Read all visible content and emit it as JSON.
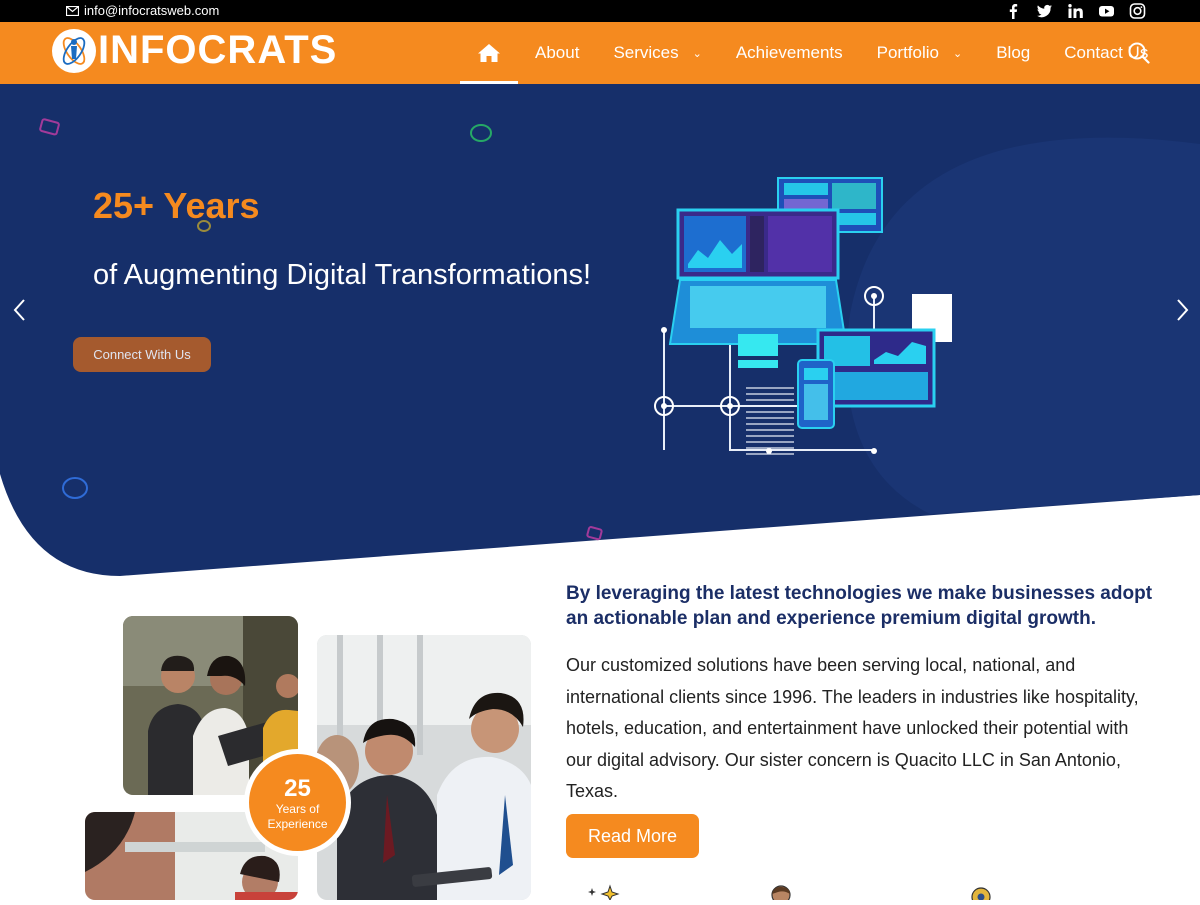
{
  "topbar": {
    "email": "info@infocratsweb.com",
    "social": [
      "facebook-icon",
      "twitter-icon",
      "linkedin-icon",
      "youtube-icon",
      "instagram-icon"
    ]
  },
  "header": {
    "logo_text": "INFOCRATS",
    "nav": [
      {
        "label": "About"
      },
      {
        "label": "Services"
      },
      {
        "label": "Achievements"
      },
      {
        "label": "Portfolio"
      },
      {
        "label": "Blog"
      },
      {
        "label": "Contact Us"
      }
    ]
  },
  "hero": {
    "title": "25+ Years",
    "subtitle": "of Augmenting Digital Transformations!",
    "cta": "Connect With Us"
  },
  "about": {
    "badge_number": "25",
    "badge_text": "Years of Experience",
    "lead": "By leveraging the latest technologies we make businesses adopt an actionable plan and experience premium digital growth.",
    "body": "Our customized solutions have been serving local, national, and international clients since 1996. The leaders in industries like hospitality, hotels, education, and entertainment have unlocked their potential with our digital advisory. Our sister concern is Quacito LLC in San Antonio, Texas.",
    "read_more": "Read More"
  },
  "colors": {
    "brand_orange": "#f58a1f",
    "hero_navy": "#162f6a",
    "text_navy": "#1b2e66"
  }
}
